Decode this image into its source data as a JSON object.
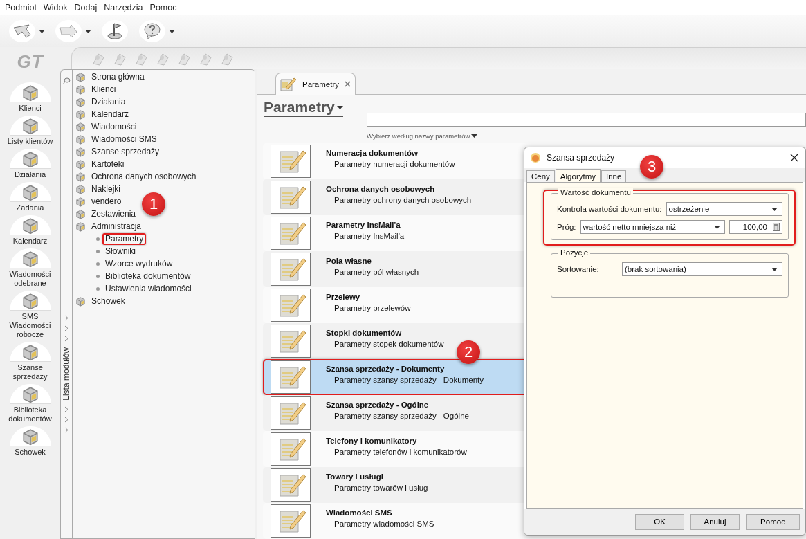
{
  "menu": [
    {
      "label": "Podmiot"
    },
    {
      "label": "Widok"
    },
    {
      "label": "Dodaj"
    },
    {
      "label": "Narzędzia"
    },
    {
      "label": "Pomoc"
    }
  ],
  "toolbar": [
    {
      "kind": "back",
      "dropdown": true
    },
    {
      "kind": "forward",
      "dropdown": true
    },
    {
      "kind": "flag",
      "dropdown": false
    },
    {
      "kind": "help",
      "dropdown": true
    }
  ],
  "logo": "GT",
  "nav": [
    {
      "label": "Klienci"
    },
    {
      "label": "Listy klientów"
    },
    {
      "label": "Działania"
    },
    {
      "label": "Zadania"
    },
    {
      "label": "Kalendarz"
    },
    {
      "label": "Wiadomości odebrane"
    },
    {
      "label": "SMS Wiadomości robocze"
    },
    {
      "label": "Szanse sprzedaży"
    },
    {
      "label": "Biblioteka dokumentów"
    },
    {
      "label": "Schowek"
    }
  ],
  "module_strip": {
    "title": "Lista modułów"
  },
  "tree": [
    {
      "label": "Strona główna"
    },
    {
      "label": "Klienci"
    },
    {
      "label": "Działania"
    },
    {
      "label": "Kalendarz"
    },
    {
      "label": "Wiadomości"
    },
    {
      "label": "Wiadomości SMS"
    },
    {
      "label": "Szanse sprzedaży"
    },
    {
      "label": "Kartoteki"
    },
    {
      "label": "Ochrona danych osobowych"
    },
    {
      "label": "Naklejki"
    },
    {
      "label": "vendero"
    },
    {
      "label": "Zestawienia"
    },
    {
      "label": "Administracja",
      "children": [
        {
          "label": "Parametry",
          "annotated": true
        },
        {
          "label": "Słowniki",
          "annotated": false
        },
        {
          "label": "Wzorce wydruków",
          "annotated": false
        },
        {
          "label": "Biblioteka dokumentów",
          "annotated": false
        },
        {
          "label": "Ustawienia wiadomości",
          "annotated": false
        }
      ]
    },
    {
      "label": "Schowek"
    }
  ],
  "tab": {
    "label": "Parametry",
    "closable": true
  },
  "heading": "Parametry",
  "filter_link": "Wybierz według nazwy parametrów",
  "parameters": [
    {
      "title": "Numeracja dokumentów",
      "description": "Parametry numeracji dokumentów",
      "selected": false,
      "annotated": false
    },
    {
      "title": "Ochrona danych osobowych",
      "description": "Parametry ochrony danych osobowych",
      "selected": false,
      "annotated": false
    },
    {
      "title": "Parametry InsMail'a",
      "description": "Parametry InsMail'a",
      "selected": false,
      "annotated": false
    },
    {
      "title": "Pola własne",
      "description": "Parametry pól własnych",
      "selected": false,
      "annotated": false
    },
    {
      "title": "Przelewy",
      "description": "Parametry przelewów",
      "selected": false,
      "annotated": false
    },
    {
      "title": "Stopki dokumentów",
      "description": "Parametry stopek dokumentów",
      "selected": false,
      "annotated": false
    },
    {
      "title": "Szansa sprzedaży - Dokumenty",
      "description": "Parametry szansy sprzedaży - Dokumenty",
      "selected": true,
      "annotated": true
    },
    {
      "title": "Szansa sprzedaży - Ogólne",
      "description": "Parametry szansy sprzedaży - Ogólne",
      "selected": false,
      "annotated": false
    },
    {
      "title": "Telefony i komunikatory",
      "description": "Parametry telefonów i komunikatorów",
      "selected": false,
      "annotated": false
    },
    {
      "title": "Towary i usługi",
      "description": "Parametry towarów i usług",
      "selected": false,
      "annotated": false
    },
    {
      "title": "Wiadomości SMS",
      "description": "Parametry wiadomości SMS",
      "selected": false,
      "annotated": false
    }
  ],
  "dialog": {
    "title": "Szansa sprzedaży",
    "tabs": [
      {
        "label": "Ceny",
        "selected": false
      },
      {
        "label": "Algorytmy",
        "selected": true
      },
      {
        "label": "Inne",
        "selected": false
      }
    ],
    "groups": [
      {
        "title": "Wartość dokumentu",
        "annotated": true,
        "fields": [
          {
            "label": "Kontrola wartości dokumentu:",
            "kind": "select",
            "value": "ostrzeżenie"
          },
          {
            "label": "Próg:",
            "kind": "select_number",
            "value": "wartość netto mniejsza niż",
            "number": "100,00"
          }
        ]
      },
      {
        "title": "Pozycje",
        "annotated": false,
        "fields": [
          {
            "label": "Sortowanie:",
            "kind": "select",
            "value": "(brak sortowania)"
          }
        ]
      }
    ],
    "buttons": [
      "OK",
      "Anuluj",
      "Pomoc"
    ]
  },
  "callouts": [
    {
      "label": "1"
    },
    {
      "label": "2"
    },
    {
      "label": "3"
    }
  ]
}
